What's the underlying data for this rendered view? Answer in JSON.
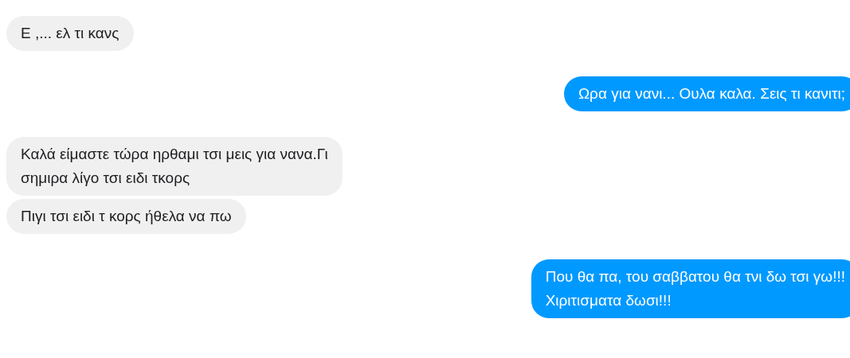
{
  "messages": [
    {
      "kind": "incoming",
      "lines": [
        "Ε ,... ελ τι κανς"
      ]
    },
    {
      "kind": "outgoing",
      "lines": [
        "Ωρα για νανι... Ουλα καλα. Σεις τι κανιτι;"
      ]
    },
    {
      "kind": "incoming",
      "lines": [
        "Καλά είμαστε τώρα ηρθαμι τσι μεις για νανα.Γι",
        "σημιρα λίγο τσι ειδι τκορς"
      ]
    },
    {
      "kind": "incoming",
      "lines": [
        "Πιγι τσι ειδι τ κορς ήθελα να πω"
      ]
    },
    {
      "kind": "outgoing",
      "lines": [
        "Που θα πα, του σαββατου θα τνι δω τσι γω!!!",
        "Χιριτισματα δωσι!!!"
      ]
    }
  ]
}
